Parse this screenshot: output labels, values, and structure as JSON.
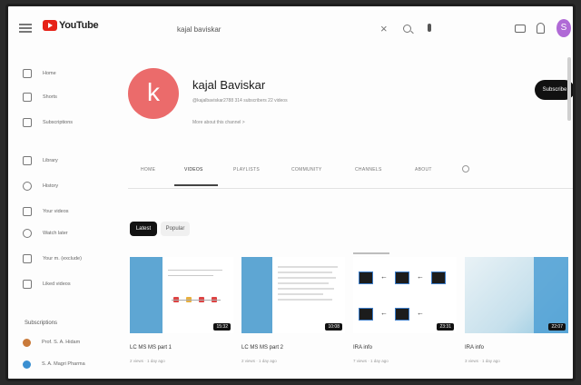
{
  "app": {
    "logo_text": "YouTube",
    "search_query": "kajal baviskar",
    "clear_glyph": "×",
    "avatar_letter": "S",
    "accent_color": "#e62117"
  },
  "sidebar": {
    "items": [
      {
        "label": "Home",
        "icon": "home-icon"
      },
      {
        "label": "Shorts",
        "icon": "shorts-icon"
      },
      {
        "label": "Subscriptions",
        "icon": "subscriptions-icon"
      },
      {
        "label": "Library",
        "icon": "library-icon"
      },
      {
        "label": "History",
        "icon": "history-icon"
      },
      {
        "label": "Your videos",
        "icon": "your-videos-icon"
      },
      {
        "label": "Watch later",
        "icon": "watch-later-icon"
      },
      {
        "label": "Your m. (exclude)",
        "icon": "your-movies-icon"
      },
      {
        "label": "Liked videos",
        "icon": "liked-videos-icon"
      }
    ],
    "subscriptions_heading": "Subscriptions",
    "subscriptions": [
      {
        "label": "Prof. S. A. Hidam",
        "color": "#c97a3a"
      },
      {
        "label": "S. A. Magri Pharma",
        "color": "#3a8fd1"
      }
    ]
  },
  "channel": {
    "avatar_letter": "k",
    "name": "kajal Baviskar",
    "meta": "@kajalbaviskar2788  314 subscribers  22 videos",
    "more_about": "More about this channel  >",
    "subscribe_label": "Subscribe",
    "avatar_color": "#eb6b6b"
  },
  "tabs": [
    {
      "label": "HOME",
      "active": false
    },
    {
      "label": "VIDEOS",
      "active": true
    },
    {
      "label": "PLAYLISTS",
      "active": false
    },
    {
      "label": "COMMUNITY",
      "active": false
    },
    {
      "label": "CHANNELS",
      "active": false
    },
    {
      "label": "ABOUT",
      "active": false
    }
  ],
  "chips": {
    "latest": "Latest",
    "popular": "Popular"
  },
  "videos": [
    {
      "title": "LC MS MS part 1",
      "meta": "2 views · 1 day ago",
      "duration": "15:32"
    },
    {
      "title": "LC MS MS part 2",
      "meta": "2 views · 1 day ago",
      "duration": "10:08"
    },
    {
      "title": "IRA info",
      "meta": "7 views · 1 day ago",
      "duration": "23:31"
    },
    {
      "title": "IRA info",
      "meta": "3 views · 1 day ago",
      "duration": "22:07"
    }
  ]
}
